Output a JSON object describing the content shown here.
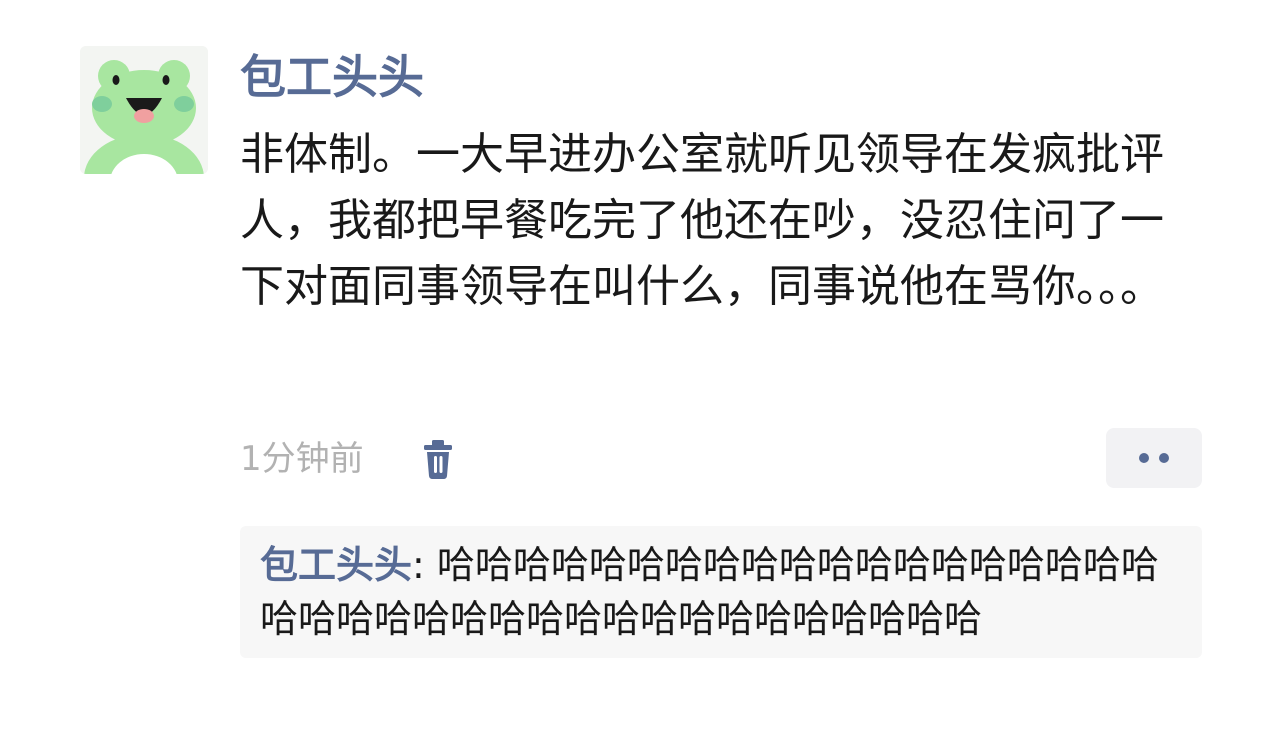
{
  "post": {
    "author": "包工头头",
    "text": "非体制。一大早进办公室就听见领导在发疯批评人，我都把早餐吃完了他还在吵，没忍住问了一下对面同事领导在叫什么，同事说他在骂你。。。",
    "timestamp": "1分钟前",
    "avatar_icon": "frog-avatar-icon"
  },
  "actions": {
    "delete_icon": "trash-icon",
    "more_icon": "more-dots-icon"
  },
  "comments": [
    {
      "author": "包工头头",
      "separator": ": ",
      "text": "哈哈哈哈哈哈哈哈哈哈哈哈哈哈哈哈哈哈哈哈哈哈哈哈哈哈哈哈哈哈哈哈哈哈哈哈哈哈"
    }
  ],
  "colors": {
    "name": "#576b95",
    "text": "#191919",
    "meta": "#b2b2b2",
    "comment_bg": "#f7f7f7",
    "frog": "#a8e6a0"
  }
}
